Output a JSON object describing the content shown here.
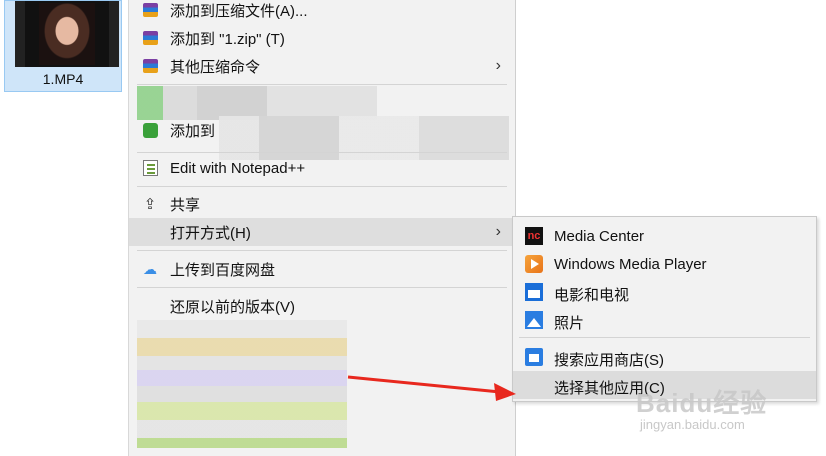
{
  "file": {
    "name": "1.MP4"
  },
  "menu": {
    "items": [
      {
        "label": "添加到压缩文件(A)...",
        "icon": "winrar-icon"
      },
      {
        "label": "添加到 \"1.zip\" (T)",
        "icon": "winrar-icon"
      },
      {
        "label": "其他压缩命令",
        "icon": "winrar-icon",
        "arrow": "›"
      },
      {
        "label": "添加到",
        "icon": "green-icon"
      },
      {
        "label": "Edit with Notepad++",
        "icon": "notepad-icon"
      },
      {
        "label": "共享",
        "icon": "share-icon"
      },
      {
        "label": "打开方式(H)",
        "arrow": "›"
      },
      {
        "label": "上传到百度网盘",
        "icon": "baidu-cloud-icon"
      },
      {
        "label": "还原以前的版本(V)"
      }
    ]
  },
  "submenu": {
    "items": [
      {
        "label": "Media Center",
        "icon": "media-center-icon",
        "icon_text": "nc"
      },
      {
        "label": "Windows Media Player",
        "icon": "windows-media-player-icon"
      },
      {
        "label": "电影和电视",
        "icon": "movies-tv-icon"
      },
      {
        "label": "照片",
        "icon": "photos-icon"
      },
      {
        "label": "搜索应用商店(S)",
        "icon": "store-icon"
      },
      {
        "label": "选择其他应用(C)"
      }
    ]
  },
  "watermark": {
    "text": "Baidu经验",
    "url_text": "jingyan.baidu.com"
  },
  "colors": {
    "menu_bg": "#f2f2f2",
    "highlight": "#dedede",
    "arrow": "#e8281e",
    "selection": "#cfe5f9"
  }
}
